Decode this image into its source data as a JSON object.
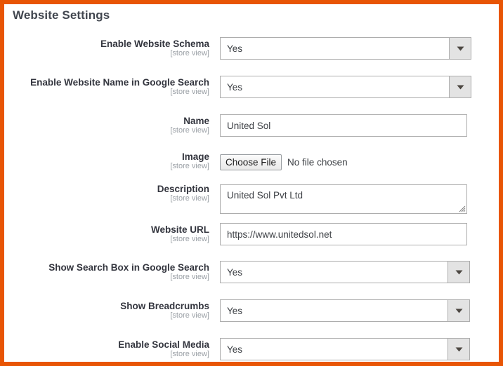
{
  "section": {
    "title": "Website Settings"
  },
  "theme": {
    "border_color": "#e85505",
    "page_background": "#ffffff",
    "label_color": "#33353e",
    "scope_color": "#9ba0a6",
    "field_border": "#adadad",
    "select_button_background": "#e3e3e3"
  },
  "scope_label": "[store view]",
  "rows": [
    {
      "label": "Enable Website Schema",
      "scope": "[store view]",
      "control": "select",
      "value": "Yes",
      "arrow_icon": "chevron-down-icon",
      "name": "enable-website-schema"
    },
    {
      "label": "Enable Website Name in Google Search",
      "scope": "[store view]",
      "control": "select",
      "value": "Yes",
      "arrow_icon": "chevron-down-icon",
      "name": "enable-website-name-in-google-search"
    },
    {
      "label": "Name",
      "scope": "[store view]",
      "control": "text",
      "value": "United Sol",
      "name": "name"
    },
    {
      "label": "Image",
      "scope": "[store view]",
      "control": "file",
      "button_label": "Choose File",
      "value": "No file chosen",
      "name": "image"
    },
    {
      "label": "Description",
      "scope": "[store view]",
      "control": "textarea",
      "value": "United Sol Pvt Ltd",
      "resize_icon": "resize-grip-icon",
      "name": "description"
    },
    {
      "label": "Website URL",
      "scope": "[store view]",
      "control": "text",
      "value": "https://www.unitedsol.net",
      "name": "website-url"
    },
    {
      "label": "Show Search Box in Google Search",
      "scope": "[store view]",
      "control": "select",
      "value": "Yes",
      "arrow_icon": "chevron-down-icon",
      "name": "show-search-box-in-google-search"
    },
    {
      "label": "Show Breadcrumbs",
      "scope": "[store view]",
      "control": "select",
      "value": "Yes",
      "arrow_icon": "chevron-down-icon",
      "name": "show-breadcrumbs"
    },
    {
      "label": "Enable Social Media",
      "scope": "[store view]",
      "control": "select",
      "value": "Yes",
      "arrow_icon": "chevron-down-icon",
      "name": "enable-social-media"
    }
  ]
}
